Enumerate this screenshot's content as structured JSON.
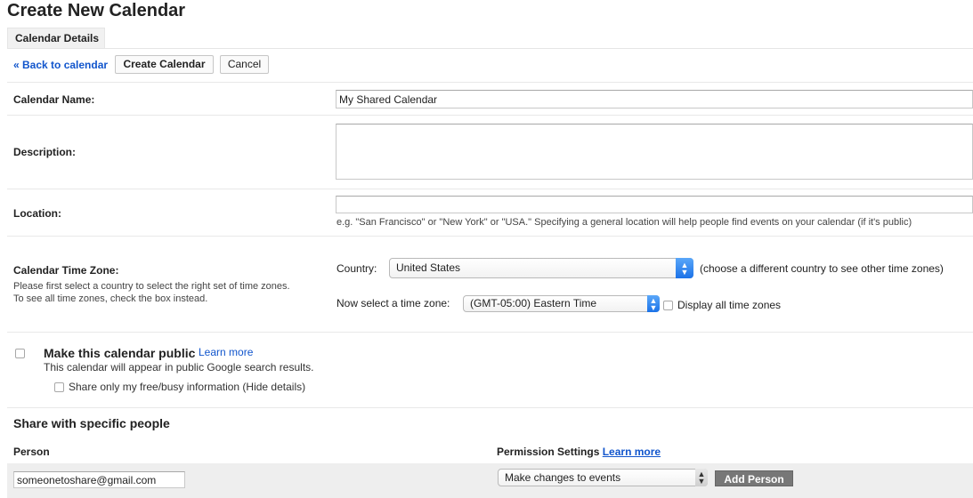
{
  "page": {
    "title": "Create New Calendar",
    "tab_label": "Calendar Details"
  },
  "toolbar": {
    "back_label": "« Back to calendar",
    "create_label": "Create Calendar",
    "cancel_label": "Cancel"
  },
  "form": {
    "name_label": "Calendar Name:",
    "name_value": "My Shared Calendar",
    "description_label": "Description:",
    "description_value": "",
    "location_label": "Location:",
    "location_value": "",
    "location_hint": "e.g. \"San Francisco\" or \"New York\" or \"USA.\" Specifying a general location will help people find events on your calendar (if it's public)",
    "timezone_label": "Calendar Time Zone:",
    "timezone_help_1": "Please first select a country to select the right set of time zones.",
    "timezone_help_2": "To see all time zones, check the box instead.",
    "country_label": "Country:",
    "country_value": "United States",
    "country_hint": "(choose a different country to see other time zones)",
    "tz_select_label": "Now select a time zone:",
    "tz_value": "(GMT-05:00) Eastern Time",
    "display_all_label": "Display all time zones"
  },
  "public": {
    "title": "Make this calendar public",
    "learn_more": "Learn more",
    "subtitle": "This calendar will appear in public Google search results.",
    "freebusy_label": "Share only my free/busy information (Hide details)"
  },
  "share": {
    "heading": "Share with specific people",
    "person_col": "Person",
    "permission_col": "Permission Settings",
    "permission_learn_more": "Learn more",
    "person_value": "someonetoshare@gmail.com",
    "permission_value": "Make changes to events",
    "add_label": "Add Person"
  },
  "colors": {
    "link": "#1155cc",
    "select_arrow": "#1b72e8",
    "add_button": "#777777"
  }
}
